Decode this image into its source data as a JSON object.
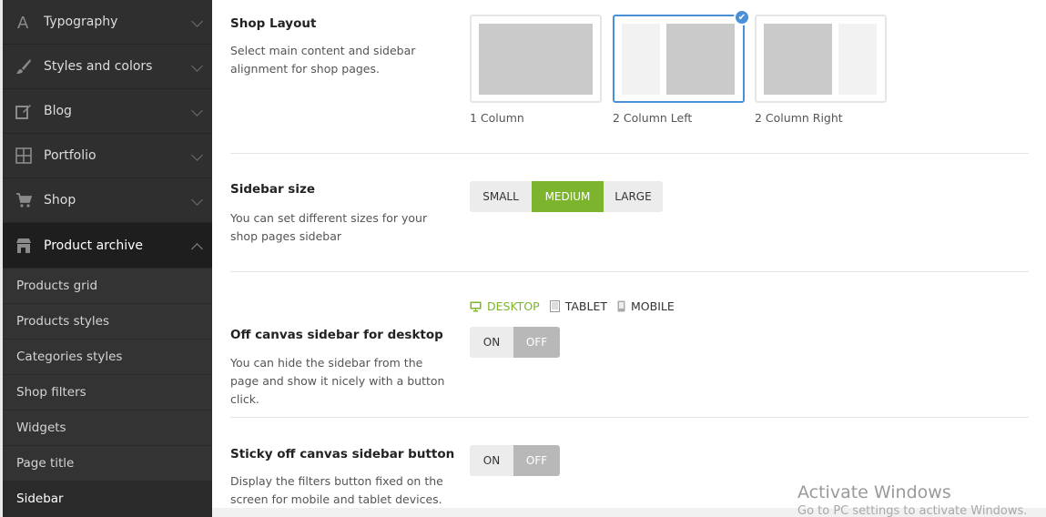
{
  "sidebar": {
    "items": [
      {
        "label": "Typography",
        "icon": "typography-icon"
      },
      {
        "label": "Styles and colors",
        "icon": "brush-icon"
      },
      {
        "label": "Blog",
        "icon": "edit-icon"
      },
      {
        "label": "Portfolio",
        "icon": "grid-icon"
      },
      {
        "label": "Shop",
        "icon": "cart-icon"
      },
      {
        "label": "Product archive",
        "icon": "store-icon",
        "expanded": true
      }
    ],
    "subitems": [
      "Products grid",
      "Products styles",
      "Categories styles",
      "Shop filters",
      "Widgets",
      "Page title",
      "Sidebar"
    ],
    "current_subitem": "Sidebar"
  },
  "shop_layout": {
    "title": "Shop Layout",
    "description": "Select main content and sidebar alignment for shop pages.",
    "options": [
      "1 Column",
      "2 Column Left",
      "2 Column Right"
    ],
    "selected": "2 Column Left"
  },
  "sidebar_size": {
    "title": "Sidebar size",
    "description": "You can set different sizes for your shop pages sidebar",
    "options": [
      "SMALL",
      "MEDIUM",
      "LARGE"
    ],
    "selected": "MEDIUM"
  },
  "devices": {
    "options": [
      "DESKTOP",
      "TABLET",
      "MOBILE"
    ],
    "selected": "DESKTOP"
  },
  "off_canvas": {
    "title": "Off canvas sidebar for desktop",
    "description": "You can hide the sidebar from the page and show it nicely with a button click.",
    "on_label": "ON",
    "off_label": "OFF",
    "value": "OFF"
  },
  "sticky_button": {
    "title": "Sticky off canvas sidebar button",
    "description": "Display the filters button fixed on the screen for mobile and tablet devices.",
    "on_label": "ON",
    "off_label": "OFF",
    "value": "OFF"
  },
  "watermark": {
    "line1": "Activate Windows",
    "line2": "Go to PC settings to activate Windows."
  },
  "colors": {
    "accent_green": "#7cb52d",
    "selected_blue": "#4a90d6",
    "sidebar_bg": "#2f2f2f"
  }
}
